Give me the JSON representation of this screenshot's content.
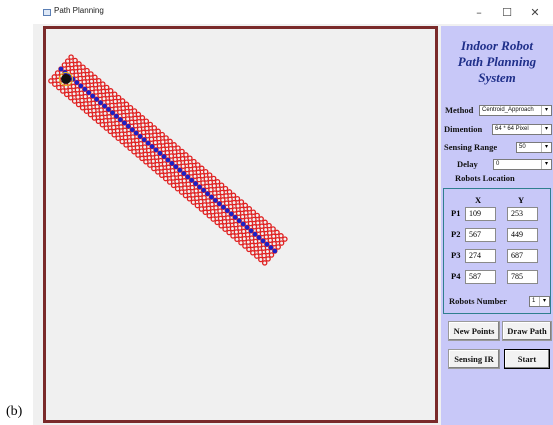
{
  "window": {
    "title": "Path Planning",
    "min_glyph": "–",
    "max_glyph": "☐",
    "close_glyph": "✕"
  },
  "caption": "(b)",
  "panel": {
    "title_line1": "Indoor Robot",
    "title_line2": "Path Planning",
    "title_line3": "System",
    "method_label": "Method",
    "method_value": "Centroid_Approach",
    "dimention_label": "Dimention",
    "dimention_value": "64 * 64 Pixel",
    "sensing_label": "Sensing Range",
    "sensing_value": "50",
    "delay_label": "Delay",
    "delay_value": "0",
    "robots_location_label": "Robots Location",
    "col_x": "X",
    "col_y": "Y",
    "robots": [
      {
        "label": "P1",
        "x": "109",
        "y": "253"
      },
      {
        "label": "P2",
        "x": "567",
        "y": "449"
      },
      {
        "label": "P3",
        "x": "274",
        "y": "687"
      },
      {
        "label": "P4",
        "x": "587",
        "y": "785"
      }
    ],
    "robots_number_label": "Robots Number",
    "robots_number_value": "1",
    "btn_new_points": "New Points",
    "btn_draw_path": "Draw Path",
    "btn_sensing_ir": "Sensing IR",
    "btn_start": "Start"
  },
  "colors": {
    "frame": "#7a2a2a",
    "panel": "#c8c8f8",
    "title": "#1f2f8a",
    "path_dot": "#1a22c8",
    "sensing_circle": "#e02020",
    "robot": "#111111"
  }
}
